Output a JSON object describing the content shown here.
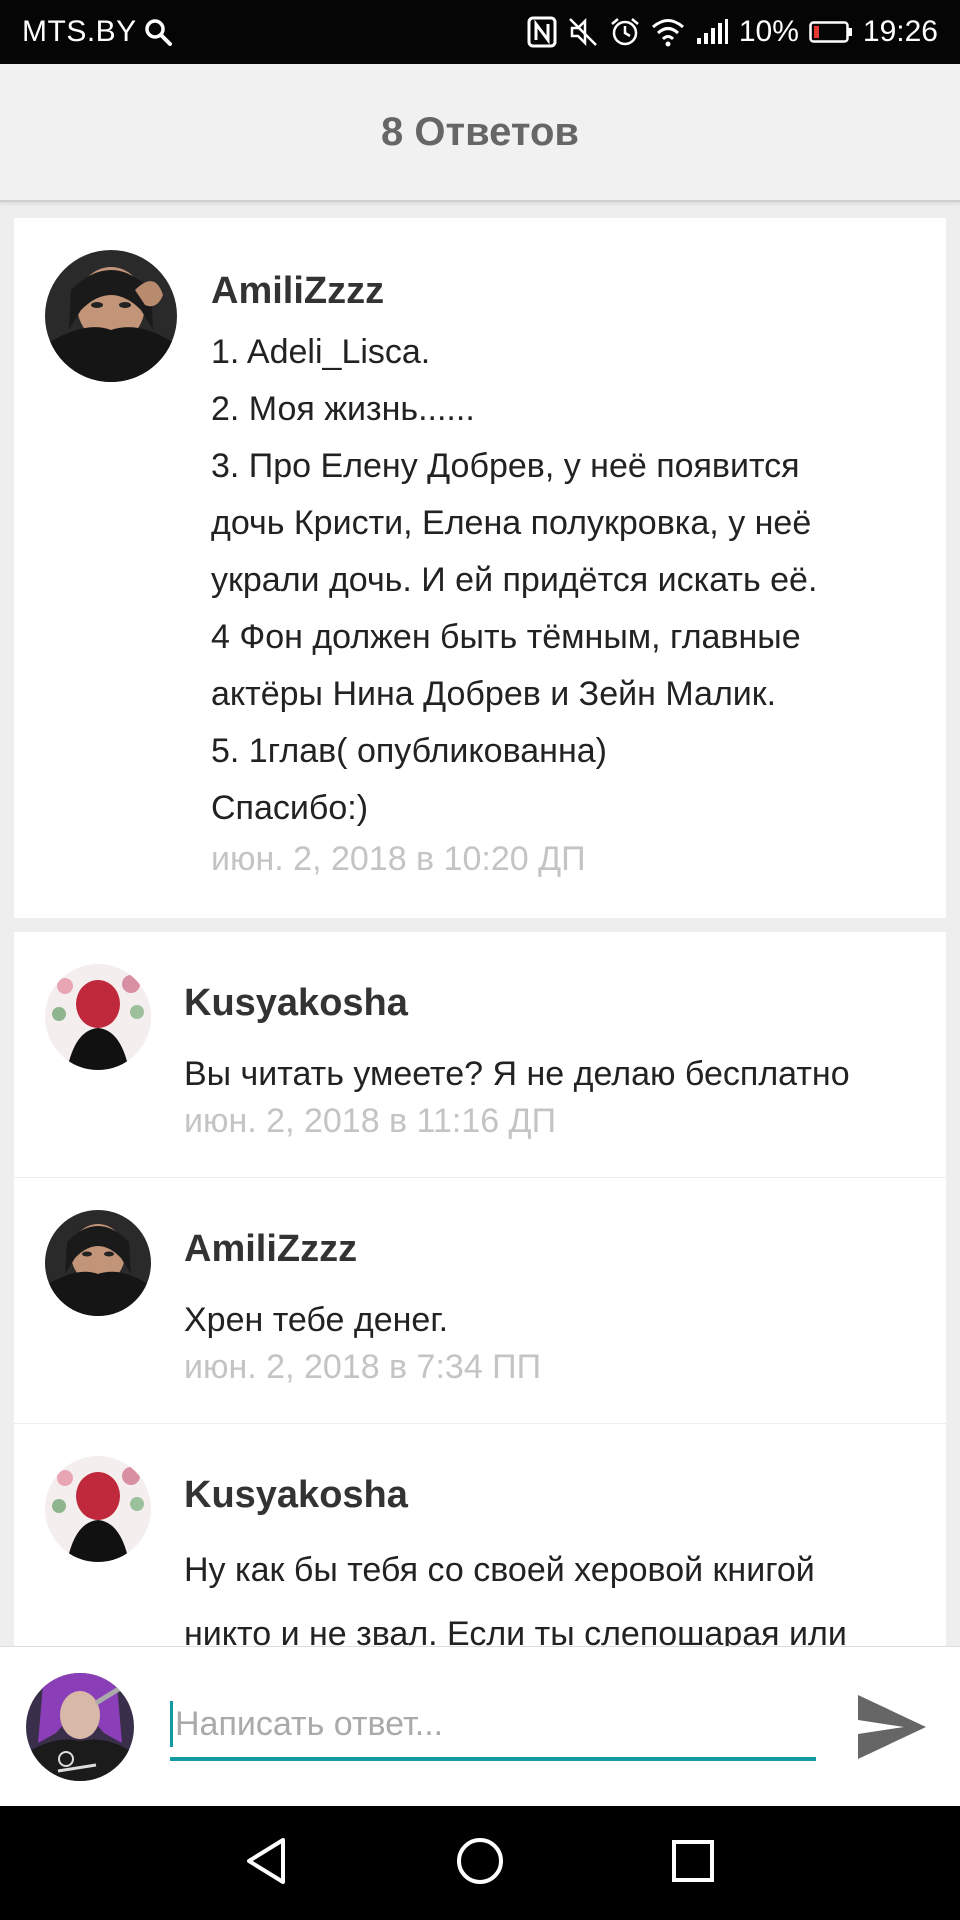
{
  "status_bar": {
    "carrier": "MTS.BY",
    "battery": "10%",
    "time": "19:26"
  },
  "header": {
    "title": "8 Ответов"
  },
  "main_comment": {
    "username": "AmiliZzzz",
    "lines": [
      "1. Adeli_Lisca.",
      "2. Моя жизнь......",
      "3. Про Елену Добрев, у неё появится",
      "дочь Кристи, Елена полукровка,  у неё",
      "украли дочь. И ей придётся искать её.",
      "4 Фон должен быть тёмным, главные",
      "актёры Нина Добрев и Зейн Малик.",
      "5. 1глав( опубликованна)",
      "Спасибо:)"
    ],
    "date": "июн. 2, 2018 в 10:20 ДП"
  },
  "replies": [
    {
      "username": "Kusyakosha",
      "text": "Вы читать умеете? Я не делаю бесплатно",
      "date": "июн. 2, 2018 в 11:16 ДП"
    },
    {
      "username": "AmiliZzzz",
      "text": "Хрен тебе денег.",
      "date": "июн. 2, 2018 в 7:34 ПП"
    },
    {
      "username": "Kusyakosha",
      "text_lines": [
        "Ну как бы тебя со своей херовой книгой",
        "никто и не звал. Если ты слепошарая или"
      ]
    }
  ],
  "compose": {
    "placeholder": "Написать ответ..."
  },
  "colors": {
    "accent": "#139aa3",
    "date_gray": "#c4c4c4",
    "header_bg": "#f1f1f1"
  }
}
